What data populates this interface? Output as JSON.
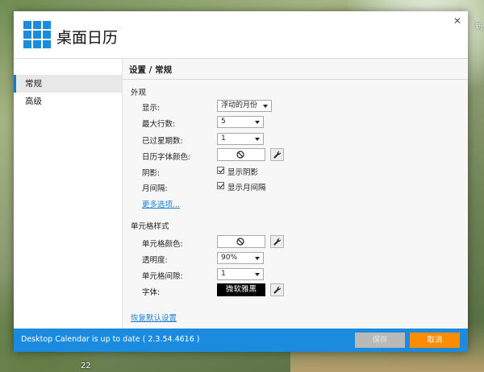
{
  "app": {
    "title": "桌面日历",
    "close_glyph": "✕"
  },
  "background": {
    "right_text": "新",
    "bottom_text": "22"
  },
  "sidebar": {
    "items": [
      {
        "label": "常规",
        "active": true
      },
      {
        "label": "高级",
        "active": false
      }
    ]
  },
  "content": {
    "heading": "设置 / 常规",
    "appearance": {
      "title": "外观",
      "display_label": "显示:",
      "display_value": "浮动的月份",
      "max_rows_label": "最大行数:",
      "max_rows_value": "5",
      "past_weeks_label": "已过星期数:",
      "past_weeks_value": "1",
      "font_color_label": "日历字体颜色:",
      "shadow_label": "阴影:",
      "shadow_check_label": "显示阴影",
      "shadow_checked": true,
      "month_gap_label": "月间隔:",
      "month_gap_check_label": "显示月间隔",
      "month_gap_checked": true,
      "more_options": "更多选项..."
    },
    "cell_style": {
      "title": "单元格样式",
      "cell_color_label": "单元格颜色:",
      "opacity_label": "透明度:",
      "opacity_value": "90%",
      "cell_gap_label": "单元格间隙:",
      "cell_gap_value": "1",
      "font_label": "字体:",
      "font_value": "微软雅黑"
    },
    "restore_defaults": "恢复默认设置"
  },
  "footer": {
    "status": "Desktop Calendar is up to date ( 2.3.54.4616 )",
    "save_label": "保存",
    "cancel_label": "取消"
  },
  "colors": {
    "accent": "#1b8be0",
    "cancel": "#ff8c00",
    "link": "#1b7fd1"
  },
  "icons": {
    "logo": "grid-logo-icon",
    "no_color": "ban-icon",
    "tool": "wrench-icon",
    "close": "close-icon",
    "dropdown": "chevron-down-icon"
  }
}
